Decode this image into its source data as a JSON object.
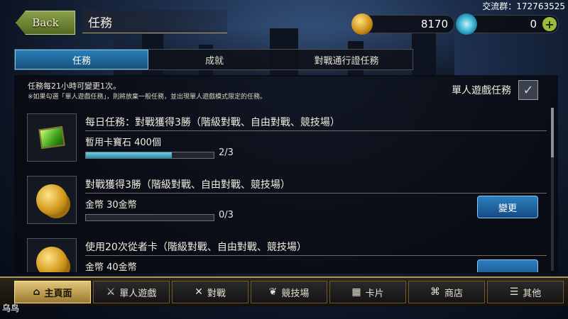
{
  "header": {
    "back_label": "Back",
    "title": "任務",
    "gold": "8170",
    "crystal": "0",
    "plus": "+",
    "qq_group": "交流群：172763525"
  },
  "tabs": [
    {
      "label": "任務",
      "active": true
    },
    {
      "label": "成就",
      "active": false
    },
    {
      "label": "對戰通行證任務",
      "active": false
    }
  ],
  "info": {
    "line1": "任務每21小時可變更1次。",
    "line2": "※如果勾選「單人遊戲任務」，則將放棄一般任務，並出現單人遊戲模式限定的任務。"
  },
  "single_player": {
    "label": "單人遊戲任務",
    "checked": true
  },
  "missions": [
    {
      "title": "每日任務：對戰獲得3勝（階級對戰、自由對戰、競技場）",
      "reward": "暫用卡寶石 400個",
      "progress": "2/3",
      "fraction": 0.67,
      "icon": "gem-icon",
      "has_change": false
    },
    {
      "title": "對戰獲得3勝（階級對戰、自由對戰、競技場）",
      "reward": "金幣 30金幣",
      "progress": "0/3",
      "fraction": 0,
      "icon": "coins-icon",
      "has_change": true,
      "change_label": "變更"
    },
    {
      "title": "使用20次從者卡（階級對戰、自由對戰、競技場）",
      "reward": "金幣 40金幣",
      "icon": "coins-icon",
      "has_change": true
    }
  ],
  "nav": [
    {
      "label": "主頁面",
      "icon": "home-icon",
      "active": true
    },
    {
      "label": "單人遊戲",
      "icon": "swords-icon",
      "active": false
    },
    {
      "label": "對戰",
      "icon": "crossed-swords-icon",
      "active": false
    },
    {
      "label": "競技場",
      "icon": "laurel-icon",
      "active": false
    },
    {
      "label": "卡片",
      "icon": "cards-icon",
      "active": false
    },
    {
      "label": "商店",
      "icon": "shop-icon",
      "active": false
    },
    {
      "label": "其他",
      "icon": "other-icon",
      "active": false
    }
  ],
  "watermark": "乌鸟"
}
